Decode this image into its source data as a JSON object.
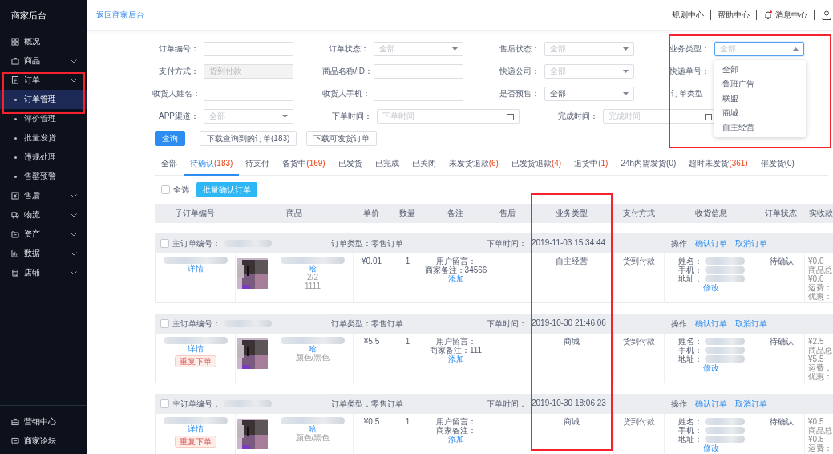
{
  "sidebar": {
    "title": "商家后台",
    "items": [
      {
        "label": "概况",
        "expandable": false,
        "highlighted": false
      },
      {
        "label": "商品",
        "expandable": true,
        "highlighted": false
      },
      {
        "label": "订单",
        "expandable": true,
        "expanded": true,
        "highlighted": true,
        "children": [
          {
            "label": "订单管理",
            "selected": true
          },
          {
            "label": "评价管理",
            "selected": false
          },
          {
            "label": "批量发货",
            "selected": false
          },
          {
            "label": "违规处理",
            "selected": false
          },
          {
            "label": "售罄预警",
            "selected": false
          }
        ]
      },
      {
        "label": "售后",
        "expandable": true,
        "highlighted": false
      },
      {
        "label": "物流",
        "expandable": true,
        "highlighted": false
      },
      {
        "label": "资产",
        "expandable": true,
        "highlighted": false
      },
      {
        "label": "数据",
        "expandable": true,
        "highlighted": false
      },
      {
        "label": "店铺",
        "expandable": true,
        "highlighted": false
      }
    ],
    "footer": [
      {
        "label": "营销中心"
      },
      {
        "label": "商家论坛"
      }
    ]
  },
  "topbar": {
    "back_link": "返回商家后台",
    "links": [
      {
        "label": "规则中心",
        "unread": false
      },
      {
        "label": "帮助中心",
        "unread": false
      },
      {
        "label": "消息中心",
        "unread": true
      }
    ]
  },
  "filters": [
    [
      {
        "label": "订单编号：",
        "kind": "text",
        "highlighted": false
      },
      {
        "label": "订单状态：",
        "kind": "select",
        "placeholder": "全部",
        "open": false,
        "highlighted": false
      },
      {
        "label": "售后状态：",
        "kind": "select",
        "placeholder": "全部",
        "open": false,
        "highlighted": false
      },
      {
        "label": "业务类型：",
        "kind": "select",
        "placeholder": "全部",
        "open": true,
        "highlighted": true,
        "options": [
          "全部",
          "鲁班广告",
          "联盟",
          "商城",
          "自主经营"
        ]
      }
    ],
    [
      {
        "label": "支付方式：",
        "kind": "disabled",
        "value": "货到付款",
        "highlighted": false
      },
      {
        "label": "商品名称/ID：",
        "kind": "text",
        "highlighted": false
      },
      {
        "label": "快递公司：",
        "kind": "select",
        "placeholder": "全部",
        "open": false,
        "highlighted": false
      },
      {
        "label": "快递单号：",
        "kind": "covered",
        "highlighted": false
      }
    ],
    [
      {
        "label": "收货人姓名：",
        "kind": "text",
        "highlighted": false
      },
      {
        "label": "收货人手机：",
        "kind": "text",
        "highlighted": false
      },
      {
        "label": "是否预售：",
        "kind": "select",
        "value": "全部",
        "open": false,
        "highlighted": false
      },
      {
        "label": "订单类型",
        "kind": "covered",
        "highlighted": false
      }
    ],
    [
      {
        "label": "APP渠道：",
        "kind": "select",
        "placeholder": "全部",
        "open": false,
        "highlighted": false
      },
      {
        "label": "下单时间：",
        "kind": "date",
        "placeholder": "下单时间",
        "highlighted": false
      },
      {
        "label": "完成时间：",
        "kind": "date",
        "placeholder": "完成时间",
        "highlighted": false
      }
    ]
  ],
  "buttons": [
    {
      "label": "查询",
      "primary": true
    },
    {
      "label": "下载查询到的订单(183)",
      "primary": false
    },
    {
      "label": "下载可发货订单",
      "primary": false
    }
  ],
  "tabs": [
    {
      "label": "全部",
      "selected": false
    },
    {
      "label": "待确认",
      "count": "(183)",
      "count_alert": true,
      "selected": true
    },
    {
      "label": "待支付",
      "selected": false
    },
    {
      "label": "备货中",
      "count": "(169)",
      "count_alert": true,
      "selected": false
    },
    {
      "label": "已发货",
      "selected": false
    },
    {
      "label": "已完成",
      "selected": false
    },
    {
      "label": "已关闭",
      "selected": false
    },
    {
      "label": "未发货退款",
      "count": "(6)",
      "count_alert": true,
      "selected": false
    },
    {
      "label": "已发货退款",
      "count": "(4)",
      "count_alert": true,
      "selected": false
    },
    {
      "label": "退货中",
      "count": "(1)",
      "count_alert": true,
      "selected": false
    },
    {
      "label": "24h内需发货",
      "count": "(0)",
      "count_alert": false,
      "selected": false
    },
    {
      "label": "超时未发货",
      "count": "(361)",
      "count_alert": true,
      "selected": false
    },
    {
      "label": "催发货",
      "count": "(0)",
      "count_alert": false,
      "selected": false
    }
  ],
  "batch": {
    "select_all": "全选",
    "checked": false,
    "button": "批量确认订单"
  },
  "table": {
    "columns": [
      {
        "label": "子订单编号",
        "highlighted": false
      },
      {
        "label": "商品",
        "highlighted": false
      },
      {
        "label": "单价",
        "highlighted": false
      },
      {
        "label": "数量",
        "highlighted": false
      },
      {
        "label": "备注",
        "highlighted": false
      },
      {
        "label": "售后",
        "highlighted": false
      },
      {
        "label": "业务类型",
        "highlighted": true
      },
      {
        "label": "支付方式",
        "highlighted": false
      },
      {
        "label": "收货信息",
        "highlighted": false
      },
      {
        "label": "订单状态",
        "highlighted": false
      },
      {
        "label": "实收款",
        "highlighted": false
      }
    ],
    "orders": [
      {
        "checked": false,
        "number_label": "主订单编号：",
        "type_label": "订单类型：",
        "order_type": "零售订单",
        "time_label": "下单时间：",
        "time": "2019-11-03 15:34:44",
        "actions_label": "操作",
        "actions": [
          "确认订单",
          "取消订单"
        ],
        "detail_link": "详情",
        "product_link": "哈",
        "specs": [
          "2/2",
          "1111"
        ],
        "price": "¥0.01",
        "quantity": "1",
        "remarks": [
          "用户留言：",
          "商家备注：34566"
        ],
        "remark_link": "添加",
        "business_type": "自主经营",
        "payment": "货到付款",
        "receiver": [
          "姓名：",
          "手机：",
          "地址："
        ],
        "receiver_link": "修改",
        "status": "待确认",
        "amounts": [
          "¥0.0",
          "商品总",
          "¥0.0",
          "运费：",
          "优惠："
        ]
      },
      {
        "checked": false,
        "number_label": "主订单编号：",
        "type_label": "订单类型：",
        "order_type": "零售订单",
        "time_label": "下单时间：",
        "time": "2019-10-30 21:46:06",
        "actions_label": "操作",
        "actions": [
          "确认订单",
          "取消订单"
        ],
        "detail_link": "详情",
        "reorder": "重复下单",
        "product_link": "哈",
        "specs": [
          "颜色/黑色"
        ],
        "price": "¥5.5",
        "quantity": "1",
        "remarks": [
          "用户留言：",
          "商家备注：111"
        ],
        "remark_link": "添加",
        "business_type": "商城",
        "payment": "货到付款",
        "receiver": [
          "姓名：",
          "手机：",
          "地址："
        ],
        "receiver_link": "修改",
        "status": "待确认",
        "amounts": [
          "¥2.5",
          "商品总",
          "¥5.5",
          "运费：",
          "优惠："
        ]
      },
      {
        "checked": false,
        "number_label": "主订单编号：",
        "type_label": "订单类型：",
        "order_type": "零售订单",
        "time_label": "下单时间：",
        "time": "2019-10-30 18:06:23",
        "actions_label": "操作",
        "actions": [
          "确认订单",
          "取消订单"
        ],
        "detail_link": "详情",
        "reorder": "重复下单",
        "product_link": "哈",
        "specs": [
          "颜色/黑色"
        ],
        "price": "¥0.5",
        "quantity": "1",
        "remarks": [
          "用户留言：",
          "商家备注："
        ],
        "remark_link": "添加",
        "business_type": "商城",
        "payment": "货到付款",
        "receiver": [
          "姓名：",
          "手机：",
          "地址："
        ],
        "receiver_link": "修改",
        "status": "待确认",
        "amounts": [
          "¥0.5",
          "商品总",
          "¥0.5",
          "运费："
        ]
      }
    ]
  }
}
